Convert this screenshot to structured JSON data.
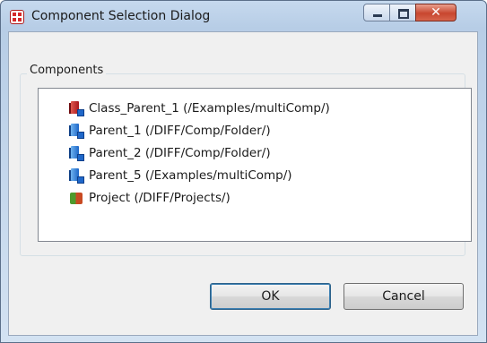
{
  "window": {
    "title": "Component Selection Dialog",
    "controls": {
      "minimize": "minimize",
      "maximize": "maximize",
      "close": "✕"
    }
  },
  "group": {
    "label": "Components"
  },
  "components": [
    {
      "label": "Class_Parent_1 (/Examples/multiComp/)",
      "icon": "class-component-icon"
    },
    {
      "label": "Parent_1 (/DIFF/Comp/Folder/)",
      "icon": "component-icon"
    },
    {
      "label": "Parent_2 (/DIFF/Comp/Folder/)",
      "icon": "component-icon"
    },
    {
      "label": "Parent_5 (/Examples/multiComp/)",
      "icon": "component-icon"
    },
    {
      "label": "Project (/DIFF/Projects/)",
      "icon": "project-icon"
    }
  ],
  "buttons": {
    "ok": "OK",
    "cancel": "Cancel"
  }
}
